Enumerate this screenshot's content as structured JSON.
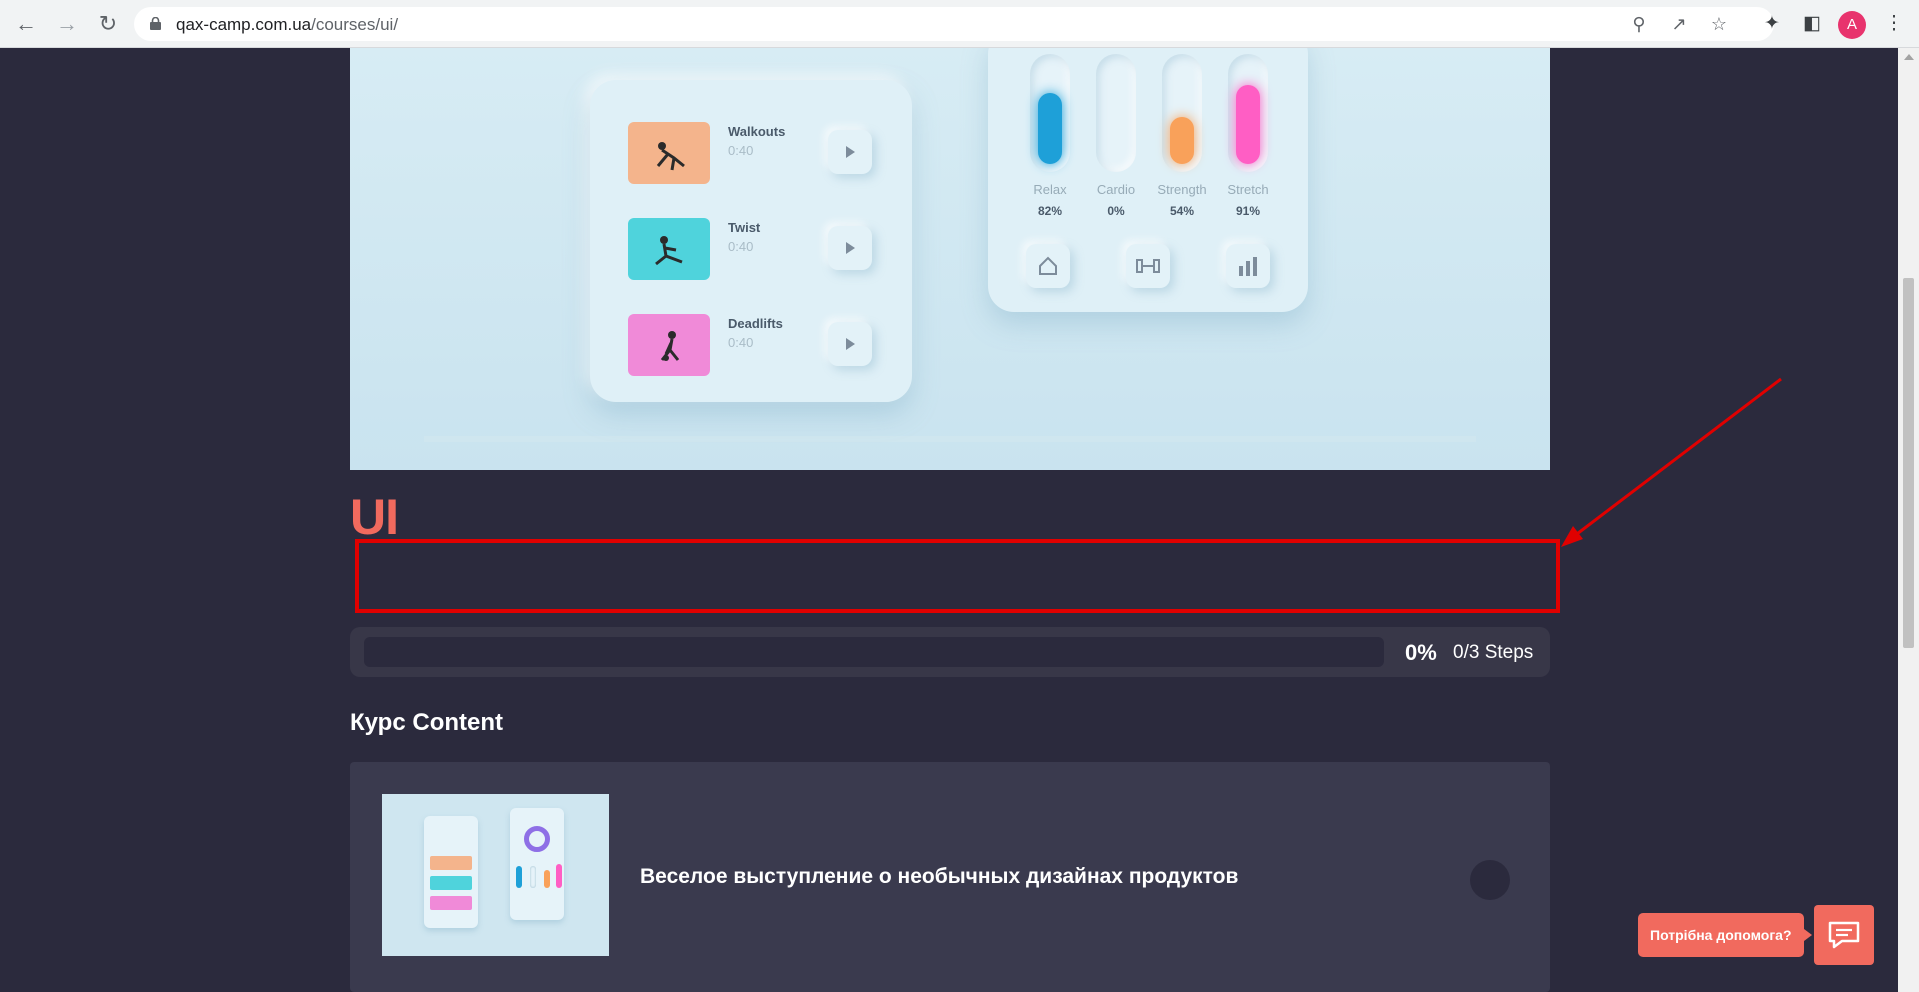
{
  "browser": {
    "url_domain": "qax-camp.com.ua",
    "url_path": "/courses/ui/",
    "profile_initial": "A"
  },
  "hero": {
    "exercises": [
      {
        "name": "Walkouts",
        "time": "0:40",
        "color": "#f4b48c"
      },
      {
        "name": "Twist",
        "time": "0:40",
        "color": "#4fd3dc"
      },
      {
        "name": "Deadlifts",
        "time": "0:40",
        "color": "#f08ad8"
      }
    ],
    "stats": [
      {
        "label": "Relax",
        "value": "82%",
        "level": 0.82,
        "color": "#1ea0d8"
      },
      {
        "label": "Cardio",
        "value": "0%",
        "level": 0,
        "color": "#e6f3f9"
      },
      {
        "label": "Strength",
        "value": "54%",
        "level": 0.54,
        "color": "#f9a15a"
      },
      {
        "label": "Stretch",
        "value": "91%",
        "level": 0.91,
        "color": "#ff5ec4"
      }
    ]
  },
  "course": {
    "title": "UI",
    "progress_percent": "0%",
    "progress_value": 0,
    "steps": "0/3 Steps"
  },
  "content": {
    "heading": "Курс Content",
    "lessons": [
      {
        "title": "Веселое выступление о необычных дизайнах продуктов"
      }
    ]
  },
  "help": {
    "label": "Потрібна допомога?"
  },
  "colors": {
    "accent": "#f16a5e",
    "page_bg": "#2b2a3d",
    "annotation": "#e00000"
  }
}
